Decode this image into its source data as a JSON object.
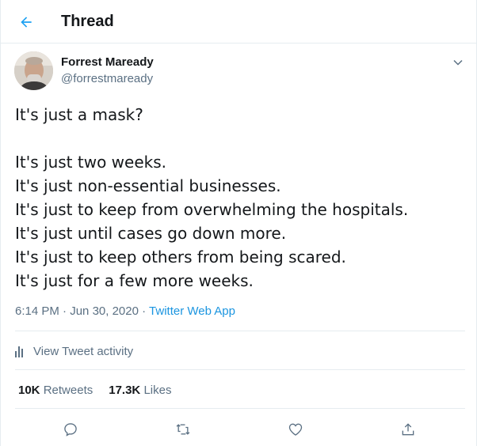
{
  "header": {
    "title": "Thread",
    "back_icon": "arrow-left-icon"
  },
  "author": {
    "name": "Forrest Maready",
    "handle": "@forrestmaready",
    "avatar_icon": "profile-photo"
  },
  "tweet": {
    "lines": [
      "It's just a mask?",
      "",
      "It's just two weeks.",
      "It's just non-essential businesses.",
      "It's just to keep from overwhelming the hospitals.",
      "It's just until cases go down more.",
      "It's just to keep others from being scared.",
      "It's just for a few more weeks."
    ],
    "time": "6:14 PM",
    "date": "Jun 30, 2020",
    "separator": "·",
    "source": "Twitter Web App"
  },
  "activity": {
    "label": "View Tweet activity"
  },
  "stats": {
    "retweets_count": "10K",
    "retweets_label": "Retweets",
    "likes_count": "17.3K",
    "likes_label": "Likes"
  },
  "actions": [
    "reply-icon",
    "retweet-icon",
    "like-icon",
    "share-icon"
  ],
  "colors": {
    "accent": "#1da1f2",
    "link": "#1b95e0",
    "secondary_text": "#5b7083",
    "border": "#e6ecf0"
  }
}
